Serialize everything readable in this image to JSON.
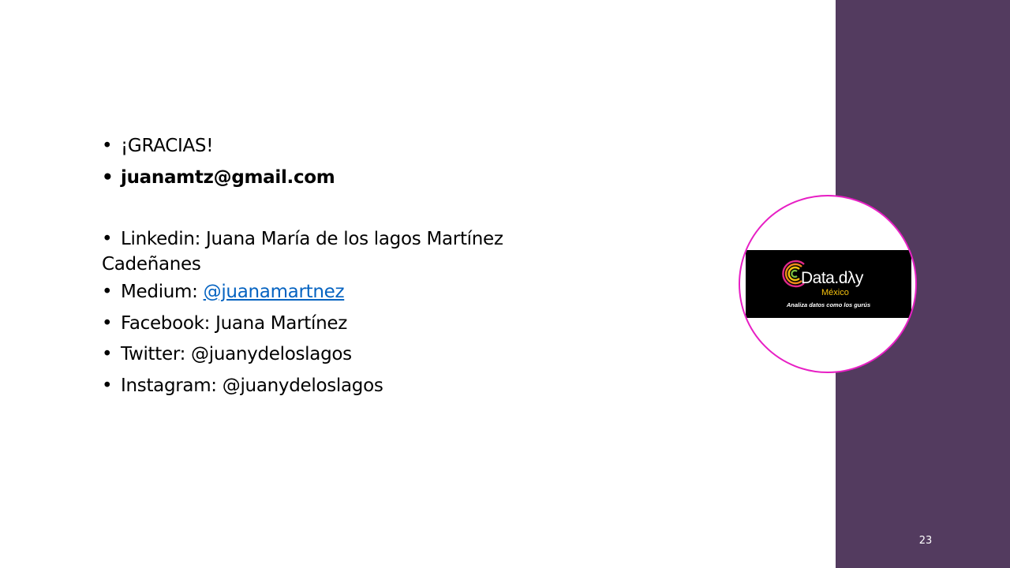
{
  "theme": {
    "panel_color": "#533b5f",
    "circle_border": "#e71fc4",
    "link_color": "#0563c1",
    "logo_band": "#000000",
    "logo_subtitle_color": "#f6c20f"
  },
  "content": {
    "items": [
      {
        "bullet": "•",
        "text": "¡GRACIAS!"
      },
      {
        "bullet": "•",
        "text": "juanamtz@gmail.com"
      },
      {
        "bullet": "•",
        "text": "Linkedin: Juana María de los lagos Martínez",
        "continuation": "Cadeñanes"
      },
      {
        "bullet": "•",
        "label": "Medium: ",
        "link": "@juanamartnez"
      },
      {
        "bullet": "•",
        "text": "Facebook: Juana Martínez"
      },
      {
        "bullet": "•",
        "text": "Twitter: @juanydeloslagos"
      },
      {
        "bullet": "•",
        "text": "Instagram: @juanydeloslagos"
      }
    ]
  },
  "logo": {
    "title": "Data.dλy",
    "subtitle": "México",
    "tagline": "Analiza datos como los gurús"
  },
  "slide_number": "23"
}
